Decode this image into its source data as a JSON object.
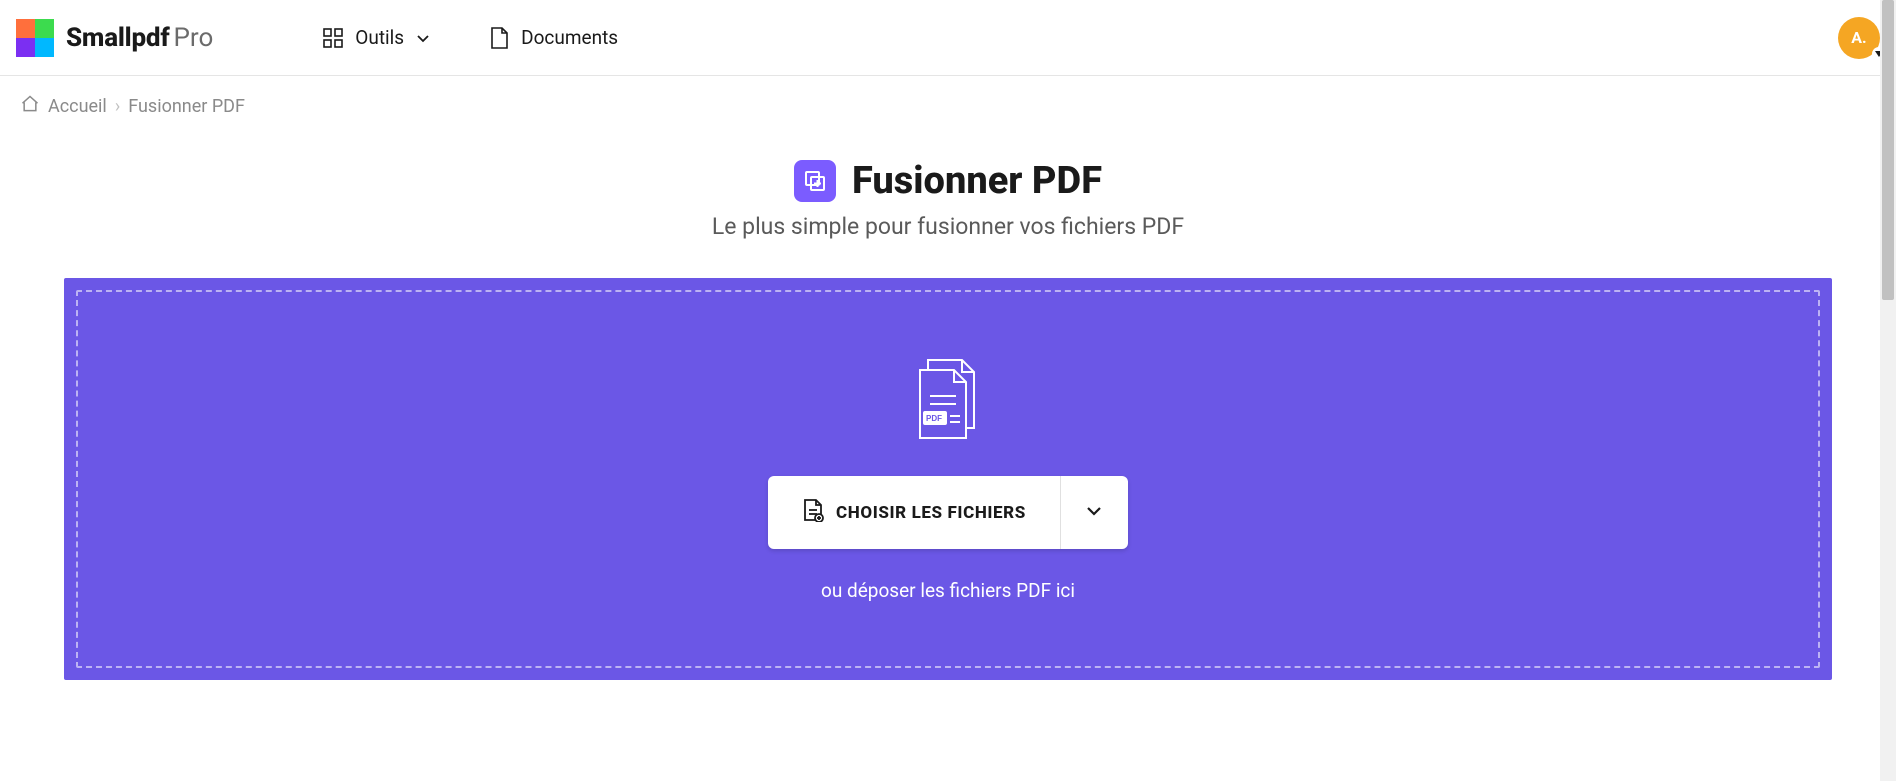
{
  "brand": {
    "name": "Smallpdf",
    "tier": "Pro"
  },
  "nav": {
    "tools": "Outils",
    "documents": "Documents"
  },
  "avatar": {
    "initials": "A."
  },
  "breadcrumb": {
    "home": "Accueil",
    "current": "Fusionner PDF"
  },
  "page": {
    "title": "Fusionner PDF",
    "subtitle": "Le plus simple pour fusionner vos fichiers PDF"
  },
  "dropzone": {
    "choose_label": "CHOISIR LES FICHIERS",
    "drop_text": "ou déposer les fichiers PDF ici"
  },
  "colors": {
    "accent": "#6b57e6",
    "avatar": "#f5a623"
  }
}
